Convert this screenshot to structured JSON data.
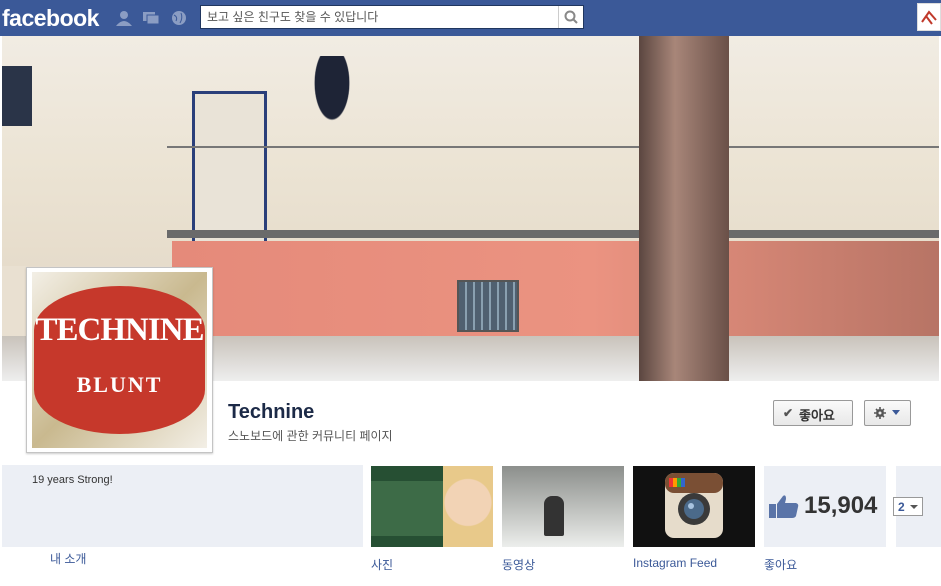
{
  "header": {
    "logo": "facebook",
    "search_placeholder": "보고 싶은 친구도 찾을 수 있답니다"
  },
  "page": {
    "name": "Technine",
    "category": "스노보드에 관한 커뮤니티 페이지",
    "avatar_line1": "TECHNINE",
    "avatar_line2": "BLUNT"
  },
  "actions": {
    "like_check": "✔",
    "like_label": "좋아요"
  },
  "about": {
    "text": "19 years Strong!",
    "link": "내 소개"
  },
  "apps": [
    {
      "label": "사진"
    },
    {
      "label": "동영상"
    },
    {
      "label": "Instagram Feed"
    },
    {
      "label": "좋아요",
      "count": "15,904"
    }
  ],
  "pager": {
    "value": "2"
  }
}
